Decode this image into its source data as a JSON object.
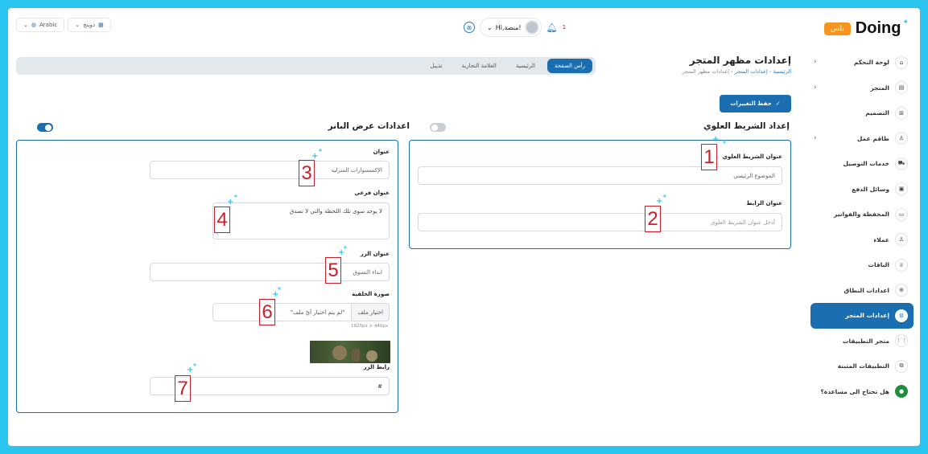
{
  "header": {
    "logo_badge": "بلس",
    "logo_text": "Doing",
    "user_greeting": "Hi,منصة!",
    "notif_count": "1",
    "store_selector": "دوينج",
    "language_selector": "Arabic"
  },
  "sidebar": {
    "items": [
      {
        "label": "لوحة التحكم",
        "icon": "⌂"
      },
      {
        "label": "المتجر",
        "icon": "▤"
      },
      {
        "label": "التصميم",
        "icon": "⊞"
      },
      {
        "label": "طاقم عمل",
        "icon": "♙"
      },
      {
        "label": "خدمات التوصيل",
        "icon": "⛟"
      },
      {
        "label": "وسائل الدفع",
        "icon": "▣"
      },
      {
        "label": "المحفظة والفواتير",
        "icon": "▭"
      },
      {
        "label": "عملاء",
        "icon": "♙"
      },
      {
        "label": "الباقات",
        "icon": "♕"
      },
      {
        "label": "اعدادات النطاق",
        "icon": "⊕"
      },
      {
        "label": "إعدادات المتجر",
        "icon": "⚙"
      },
      {
        "label": "متجر التطبيقات",
        "icon": "⋮⋮"
      },
      {
        "label": "التطبيقات المثبتة",
        "icon": "⧉"
      },
      {
        "label": "هل تحتاج الى مساعدة؟",
        "icon": "●"
      }
    ]
  },
  "page": {
    "title": "إعدادات مظهر المتجر",
    "breadcrumb": {
      "home": "الرئيسية",
      "store_settings": "إعدادات المتجر",
      "current": "إعدادات مظهر المتجر"
    },
    "tabs": [
      "رأس الصفحة",
      "الرئيسية",
      "العلامة التجارية",
      "تذييل"
    ],
    "save_label": "حفظ التغييرات"
  },
  "top_bar_section": {
    "title": "إعداد الشريط العلوي",
    "toggle_on": false,
    "fields": {
      "title_label": "عنوان الشريط العلوي",
      "title_value": "الموضوع الرئيسي",
      "link_label": "عنوان الرابط",
      "link_placeholder": "أدخل عنوان الشريط العلوي"
    }
  },
  "banner_section": {
    "title": "اعدادات عرض البانر",
    "toggle_on": true,
    "fields": {
      "title_label": "عنوان",
      "title_value": "الإكسسوارات المنزلية",
      "subtitle_label": "عنوان فرعي",
      "subtitle_value": "لا يوجد سوى تلك اللحظة والتي لا تصدق",
      "button_title_label": "عنوان الزر",
      "button_title_value": "ابداء التسوق",
      "background_label": "صورة الخلفية",
      "file_button": "اختيار ملف",
      "file_status": "\"لم يتم اختيار أيّ ملف\"",
      "dimension_hint": "1920px × 440px",
      "button_link_label": "رابط الزر",
      "button_link_value": "#"
    }
  },
  "annotations": [
    "1",
    "2",
    "3",
    "4",
    "5",
    "6",
    "7"
  ],
  "colors": {
    "accent": "#1b6fb0",
    "frame": "#2bc4ee",
    "annotation": "#c8202a",
    "badge": "#f7941d"
  }
}
